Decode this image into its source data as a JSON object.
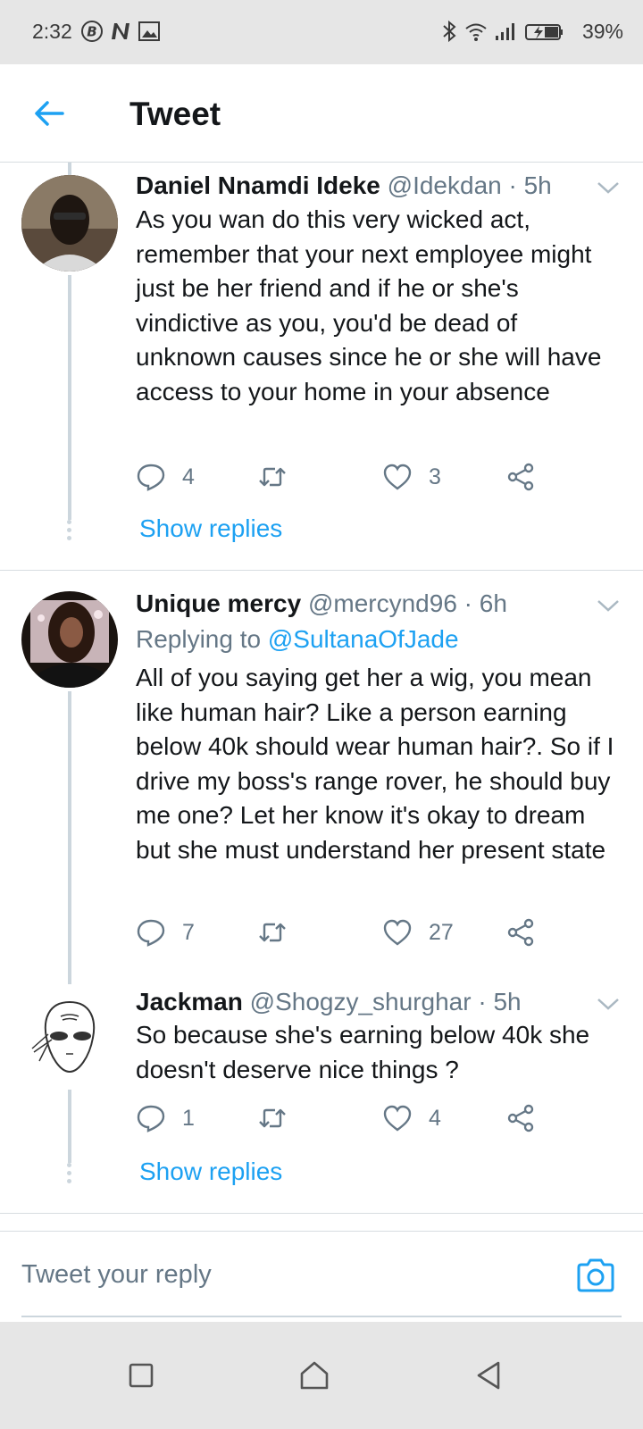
{
  "status_bar": {
    "time": "2:32",
    "battery": "39%",
    "icons_left": [
      "b-circle-icon",
      "n-icon",
      "image-icon"
    ],
    "icons_right": [
      "bluetooth-icon",
      "wifi-icon",
      "signal-icon",
      "battery-charging-icon"
    ]
  },
  "header": {
    "title": "Tweet",
    "back_icon": "arrow-left-icon"
  },
  "colors": {
    "accent": "#1da1f2",
    "secondary_text": "#657786",
    "divider": "#d8dde1",
    "thread_line": "#ccd6dd"
  },
  "tweets": [
    {
      "name": "Daniel Nnamdi Ideke",
      "meta": "@Idekdan · 5h",
      "text": "As you wan do this very wicked act, remember that your next employee might just be her friend and if he or she's vindictive as you, you'd be dead of unknown causes since he or she will have access to your home in your absence",
      "replies": "4",
      "retweets": "",
      "likes": "3",
      "show_replies": "Show replies"
    },
    {
      "name": "Unique mercy",
      "meta": "@mercynd96 · 6h",
      "replying_label": "Replying to",
      "replying_handle": "@SultanaOfJade",
      "text": "All of you saying get her a wig, you mean like human hair? Like a person earning below 40k should wear human hair?. So if I drive my boss's range rover, he should buy me one? Let her know it's okay to dream but she must understand her present state",
      "replies": "7",
      "retweets": "",
      "likes": "27"
    },
    {
      "name": "Jackman",
      "meta": "@Shogzy_shurghar · 5h",
      "text": "So because she's earning below 40k she doesn't deserve nice things ?",
      "replies": "1",
      "retweets": "",
      "likes": "4",
      "show_replies": "Show replies"
    }
  ],
  "composer": {
    "placeholder": "Tweet your reply",
    "camera_icon": "camera-icon"
  },
  "nav_bar": {
    "buttons": [
      "recents-square-icon",
      "home-circle-icon",
      "back-triangle-icon"
    ]
  }
}
